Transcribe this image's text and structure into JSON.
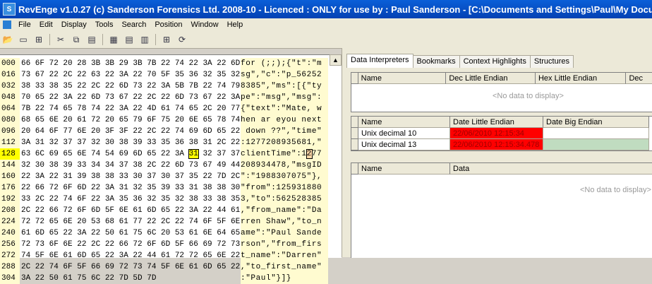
{
  "window": {
    "title": "RevEnge v1.0.27 (c) Sanderson Forensics Ltd. 2008-10 - Licenced : ONLY for use by : Paul Sanderson  - [C:\\Documents and Settings\\Paul\\My Document"
  },
  "menu": [
    "File",
    "Edit",
    "Display",
    "Tools",
    "Search",
    "Position",
    "Window",
    "Help"
  ],
  "hex_rows": [
    {
      "off": "000",
      "hex": "66 6F 72 20 28 3B 3B 29 3B 7B 22 74 22 3A 22 6D",
      "asc": "for (;;);{\"t\":\"m"
    },
    {
      "off": "016",
      "hex": "73 67 22 2C 22 63 22 3A 22 70 5F 35 36 32 35 32",
      "asc": "sg\",\"c\":\"p_56252"
    },
    {
      "off": "032",
      "hex": "38 33 38 35 22 2C 22 6D 73 22 3A 5B 7B 22 74 79",
      "asc": "8385\",\"ms\":[{\"ty"
    },
    {
      "off": "048",
      "hex": "70 65 22 3A 22 6D 73 67 22 2C 22 6D 73 67 22 3A",
      "asc": "pe\":\"msg\",\"msg\":"
    },
    {
      "off": "064",
      "hex": "7B 22 74 65 78 74 22 3A 22 4D 61 74 65 2C 20 77",
      "asc": "{\"text\":\"Mate, w"
    },
    {
      "off": "080",
      "hex": "68 65 6E 20 61 72 20 65 79 6F 75 20 6E 65 78 74",
      "asc": "hen ar eyou next"
    },
    {
      "off": "096",
      "hex": "20 64 6F 77 6E 20 3F 3F 22 2C 22 74 69 6D 65 22",
      "asc": " down ??\",\"time\""
    },
    {
      "off": "112",
      "hex": "3A 31 32 37 37 32 30 38 39 33 35 36 38 31 2C 22",
      "asc": ":1277208935681,\""
    },
    {
      "off": "128",
      "hex": "63 6C 69 65 6E 74 54 69 6D 65 22 3A 31 32 37 37",
      "asc": "clientTime\":1277"
    },
    {
      "off": "144",
      "hex": "32 30 38 39 33 34 34 37 38 2C 22 6D 73 67 49 44",
      "asc": "208934478,\"msgID"
    },
    {
      "off": "160",
      "hex": "22 3A 22 31 39 38 38 33 30 37 30 37 35 22 7D 2C",
      "asc": "\":\"1988307075\"},"
    },
    {
      "off": "176",
      "hex": "22 66 72 6F 6D 22 3A 31 32 35 39 33 31 38 38 30",
      "asc": "\"from\":125931880"
    },
    {
      "off": "192",
      "hex": "33 2C 22 74 6F 22 3A 35 36 32 35 32 38 33 38 35",
      "asc": "3,\"to\":562528385"
    },
    {
      "off": "208",
      "hex": "2C 22 66 72 6F 6D 5F 6E 61 6D 65 22 3A 22 44 61",
      "asc": ",\"from_name\":\"Da"
    },
    {
      "off": "224",
      "hex": "72 72 65 6E 20 53 68 61 77 22 2C 22 74 6F 5F 6E",
      "asc": "rren Shaw\",\"to_n"
    },
    {
      "off": "240",
      "hex": "61 6D 65 22 3A 22 50 61 75 6C 20 53 61 6E 64 65",
      "asc": "ame\":\"Paul Sande"
    },
    {
      "off": "256",
      "hex": "72 73 6F 6E 22 2C 22 66 72 6F 6D 5F 66 69 72 73",
      "asc": "rson\",\"from_firs"
    },
    {
      "off": "272",
      "hex": "74 5F 6E 61 6D 65 22 3A 22 44 61 72 72 65 6E 22",
      "asc": "t_name\":\"Darren\""
    },
    {
      "off": "288",
      "hex": "2C 22 74 6F 5F 66 69 72 73 74 5F 6E 61 6D 65 22",
      "asc": ",\"to_first_name\""
    },
    {
      "off": "304",
      "hex": "3A 22 50 61 75 6C 22 7D 5D 7D",
      "asc": ":\"Paul\"}]}"
    }
  ],
  "tabs": [
    "Data Interpreters",
    "Bookmarks",
    "Context Highlights",
    "Structures"
  ],
  "grid1": {
    "headers": [
      "Name",
      "Dec Little Endian",
      "Hex Little Endian",
      "Dec"
    ],
    "empty": "<No data to display>"
  },
  "grid2": {
    "headers": [
      "Name",
      "Date Little Endian",
      "Date Big Endian"
    ],
    "rows": [
      {
        "name": "Unix decimal 10",
        "le": "22/06/2010 12:15:34",
        "be": "",
        "le_color": "#ff0000",
        "be_color": "#ffffff"
      },
      {
        "name": "Unix decimal 13",
        "le": "22/06/2010 12:15:34.478",
        "be": "",
        "le_color": "#ff0000",
        "be_color": "#c0dcc0"
      }
    ]
  },
  "grid3": {
    "headers": [
      "Name",
      "Data"
    ],
    "empty": "<No data to display>"
  }
}
